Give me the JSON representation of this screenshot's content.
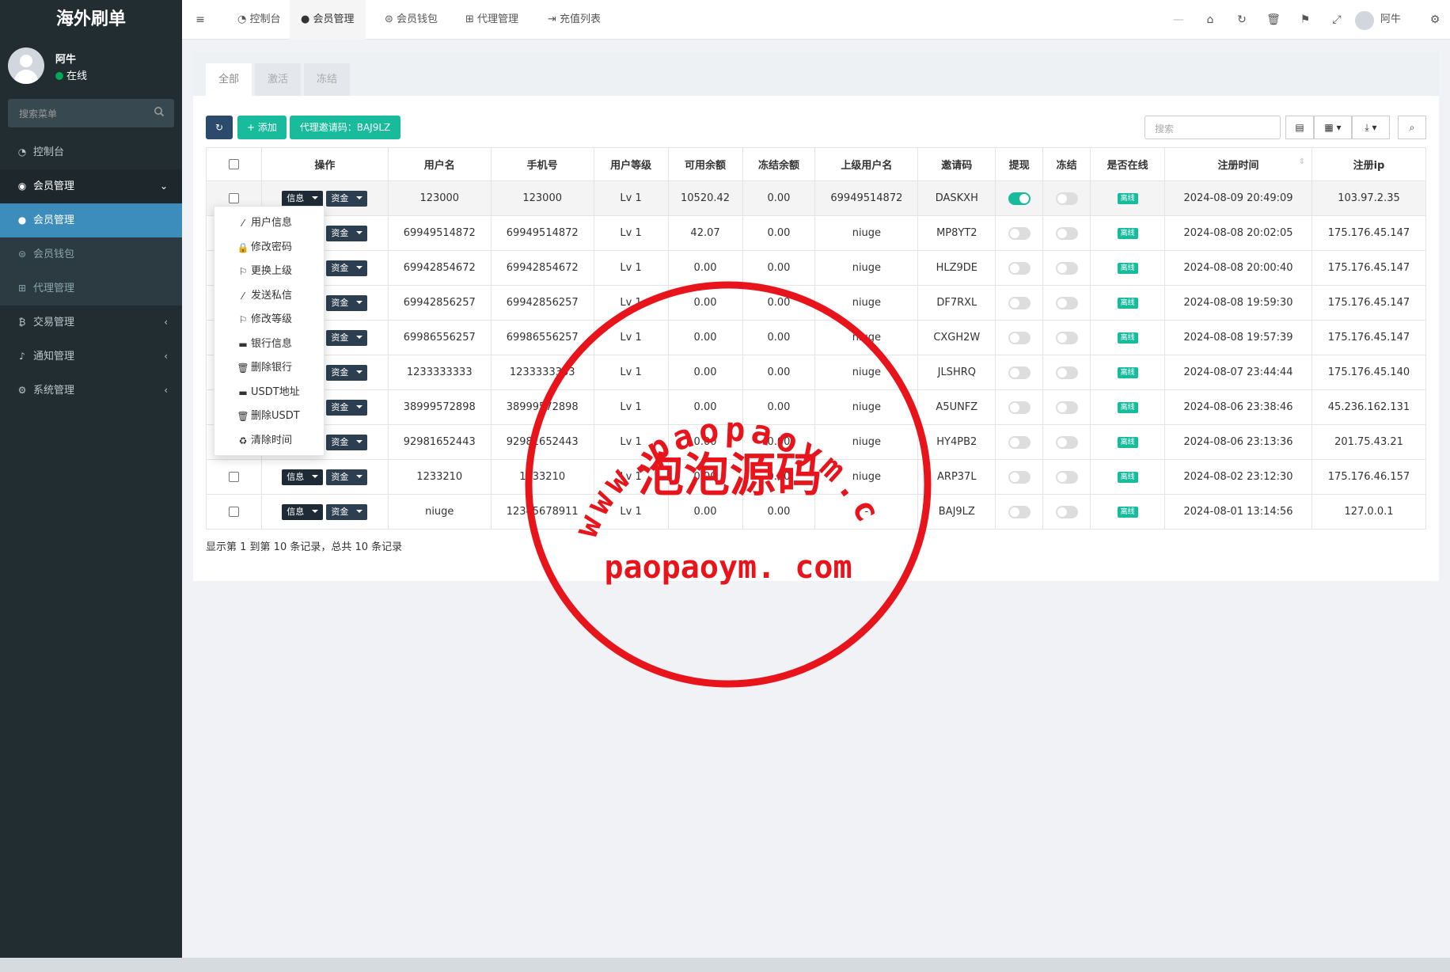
{
  "brand": "海外刷单",
  "user": {
    "name": "阿牛",
    "status": "在线"
  },
  "sidebar_search_placeholder": "搜索菜单",
  "menu": [
    {
      "label": "控制台",
      "icon": "dashboard-icon"
    },
    {
      "label": "会员管理",
      "icon": "user-circle-icon",
      "expanded": true
    },
    {
      "label": "会员管理",
      "icon": "user-icon",
      "active": true
    },
    {
      "label": "会员钱包",
      "icon": "wallet-icon"
    },
    {
      "label": "代理管理",
      "icon": "sitemap-icon"
    },
    {
      "label": "交易管理",
      "icon": "bitcoin-icon"
    },
    {
      "label": "通知管理",
      "icon": "bell-icon"
    },
    {
      "label": "系统管理",
      "icon": "cogs-icon"
    }
  ],
  "nav_tabs": [
    "控制台",
    "会员管理",
    "会员钱包",
    "代理管理",
    "充值列表"
  ],
  "header_user": "阿牛",
  "filter_tabs": [
    "全部",
    "激活",
    "冻结"
  ],
  "toolbar": {
    "add_label": "添加",
    "invite_label": "代理邀请码：BAJ9LZ",
    "search_placeholder": "搜索"
  },
  "table": {
    "columns": [
      "操作",
      "用户名",
      "手机号",
      "用户等级",
      "可用余额",
      "冻结余额",
      "上级用户名",
      "邀请码",
      "提现",
      "冻结",
      "是否在线",
      "注册时间",
      "注册ip"
    ],
    "info_label": "信息",
    "funds_label": "资金",
    "online_label": "离线",
    "rows": [
      {
        "username": "123000",
        "phone": "123000",
        "level": "Lv 1",
        "balance": "10520.42",
        "frozen": "0.00",
        "parent": "69949514872",
        "code": "DASKXH",
        "withdraw": true,
        "freeze": false,
        "time": "2024-08-09 20:49:09",
        "ip": "103.97.2.35"
      },
      {
        "username": "69949514872",
        "phone": "69949514872",
        "level": "Lv 1",
        "balance": "42.07",
        "frozen": "0.00",
        "parent": "niuge",
        "code": "MP8YT2",
        "withdraw": false,
        "freeze": false,
        "time": "2024-08-08 20:02:05",
        "ip": "175.176.45.147"
      },
      {
        "username": "69942854672",
        "phone": "69942854672",
        "level": "Lv 1",
        "balance": "0.00",
        "frozen": "0.00",
        "parent": "niuge",
        "code": "HLZ9DE",
        "withdraw": false,
        "freeze": false,
        "time": "2024-08-08 20:00:40",
        "ip": "175.176.45.147"
      },
      {
        "username": "69942856257",
        "phone": "69942856257",
        "level": "Lv 1",
        "balance": "0.00",
        "frozen": "0.00",
        "parent": "niuge",
        "code": "DF7RXL",
        "withdraw": false,
        "freeze": false,
        "time": "2024-08-08 19:59:30",
        "ip": "175.176.45.147"
      },
      {
        "username": "69986556257",
        "phone": "69986556257",
        "level": "Lv 1",
        "balance": "0.00",
        "frozen": "0.00",
        "parent": "niuge",
        "code": "CXGH2W",
        "withdraw": false,
        "freeze": false,
        "time": "2024-08-08 19:57:39",
        "ip": "175.176.45.147"
      },
      {
        "username": "1233333333",
        "phone": "1233333333",
        "level": "Lv 1",
        "balance": "0.00",
        "frozen": "0.00",
        "parent": "niuge",
        "code": "JLSHRQ",
        "withdraw": false,
        "freeze": false,
        "time": "2024-08-07 23:44:44",
        "ip": "175.176.45.140"
      },
      {
        "username": "38999572898",
        "phone": "38999572898",
        "level": "Lv 1",
        "balance": "0.00",
        "frozen": "0.00",
        "parent": "niuge",
        "code": "A5UNFZ",
        "withdraw": false,
        "freeze": false,
        "time": "2024-08-06 23:38:46",
        "ip": "45.236.162.131"
      },
      {
        "username": "92981652443",
        "phone": "92981652443",
        "level": "Lv 1",
        "balance": "0.00",
        "frozen": "0.00",
        "parent": "niuge",
        "code": "HY4PB2",
        "withdraw": false,
        "freeze": false,
        "time": "2024-08-06 23:13:36",
        "ip": "201.75.43.21"
      },
      {
        "username": "1233210",
        "phone": "1233210",
        "level": "Lv 1",
        "balance": "0.00",
        "frozen": "0.00",
        "parent": "niuge",
        "code": "ARP37L",
        "withdraw": false,
        "freeze": false,
        "time": "2024-08-02 23:12:30",
        "ip": "175.176.46.157"
      },
      {
        "username": "niuge",
        "phone": "12345678911",
        "level": "Lv 1",
        "balance": "0.00",
        "frozen": "0.00",
        "parent": "-",
        "code": "BAJ9LZ",
        "withdraw": false,
        "freeze": false,
        "time": "2024-08-01 13:14:56",
        "ip": "127.0.0.1"
      }
    ]
  },
  "summary": "显示第 1 到第 10 条记录，总共 10 条记录",
  "dropdown_items": [
    {
      "label": "用户信息",
      "icon": "magic-wand-icon"
    },
    {
      "label": "修改密码",
      "icon": "lock-icon"
    },
    {
      "label": "更换上级",
      "icon": "flag-icon"
    },
    {
      "label": "发送私信",
      "icon": "magic-wand-icon"
    },
    {
      "label": "修改等级",
      "icon": "flag-icon"
    },
    {
      "label": "银行信息",
      "icon": "credit-card-icon"
    },
    {
      "label": "删除银行",
      "icon": "trash-icon"
    },
    {
      "label": "USDT地址",
      "icon": "credit-card-icon"
    },
    {
      "label": "删除USDT",
      "icon": "trash-icon"
    },
    {
      "label": "清除时间",
      "icon": "recycle-icon"
    }
  ],
  "watermark": {
    "url_arc": "www.paopaoym.com",
    "center_text": "泡泡源码",
    "bottom_text": "paopaoym. com",
    "color": "#e8141c"
  }
}
